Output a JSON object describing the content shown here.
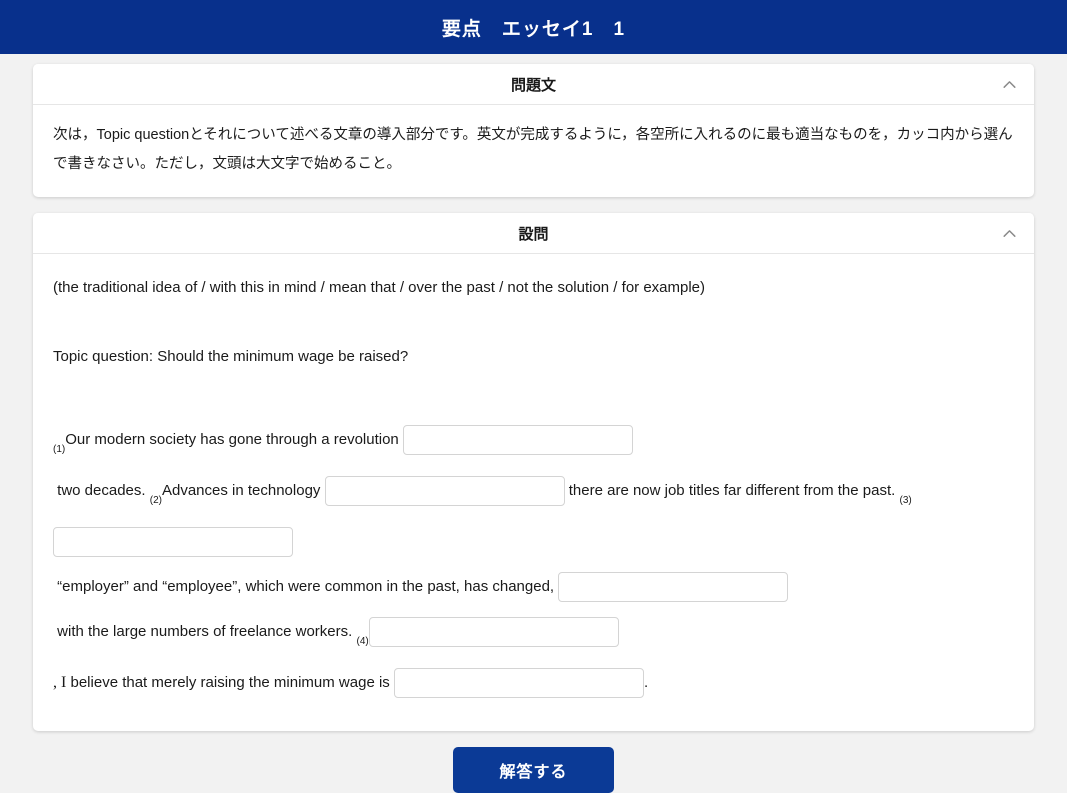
{
  "corner_tab": {
    "name": "partial-tab"
  },
  "header": {
    "title": "要点　エッセイ1　1"
  },
  "cards": [
    {
      "id": "question-text",
      "title": "問題文",
      "chevron": "chevron-up-icon",
      "body": "次は，Topic questionとそれについて述べる文章の導入部分です。英文が完成するように，各空所に入れるのに最も適当なものを，カッコ内から選んで書きなさい。ただし，文頭は大文字で始めること。"
    },
    {
      "id": "setsumon",
      "title": "設問",
      "chevron": "chevron-up-icon"
    }
  ],
  "setsumon": {
    "wordbank": "(the traditional idea of / with this in mind / mean that / over the past / not the solution / for example)",
    "topic_question": "Topic question: Should the minimum wage be raised?",
    "segments": [
      {
        "type": "marker",
        "text": "(1)"
      },
      {
        "type": "text",
        "text": "Our modern society has gone through a revolution "
      },
      {
        "type": "blank",
        "name": "blank-1",
        "value": "",
        "placeholder": ""
      },
      {
        "type": "text",
        "text": " two decades. "
      },
      {
        "type": "marker",
        "text": "(2)"
      },
      {
        "type": "text",
        "text": "Advances in technology "
      },
      {
        "type": "blank",
        "name": "blank-2",
        "value": "",
        "placeholder": ""
      },
      {
        "type": "text",
        "text": " there are now job titles far different from the past. "
      },
      {
        "type": "marker",
        "text": "(3)"
      },
      {
        "type": "blank",
        "name": "blank-3",
        "value": "",
        "placeholder": ""
      },
      {
        "type": "text",
        "text": " “employer” and “employee”, which were common in the past, has changed, "
      },
      {
        "type": "blank",
        "name": "blank-4",
        "value": "",
        "placeholder": ""
      },
      {
        "type": "text",
        "text": " with the large numbers of freelance workers. "
      },
      {
        "type": "marker",
        "text": "(4)"
      },
      {
        "type": "blank",
        "name": "blank-5",
        "value": "",
        "placeholder": ""
      },
      {
        "type": "serif",
        "text": ", I"
      },
      {
        "type": "text",
        "text": " believe that merely raising the minimum wage is "
      },
      {
        "type": "blank",
        "name": "blank-6",
        "value": "",
        "placeholder": ""
      },
      {
        "type": "text",
        "text": "."
      }
    ]
  },
  "submit": {
    "label": "解答する"
  },
  "colors": {
    "header_blue": "#08308c",
    "button_blue": "#0b3a96",
    "tab_blue": "#5978b4",
    "page_bg": "#f2f2f2",
    "card_bg": "#ffffff",
    "blank_border": "#d4d4d4"
  }
}
